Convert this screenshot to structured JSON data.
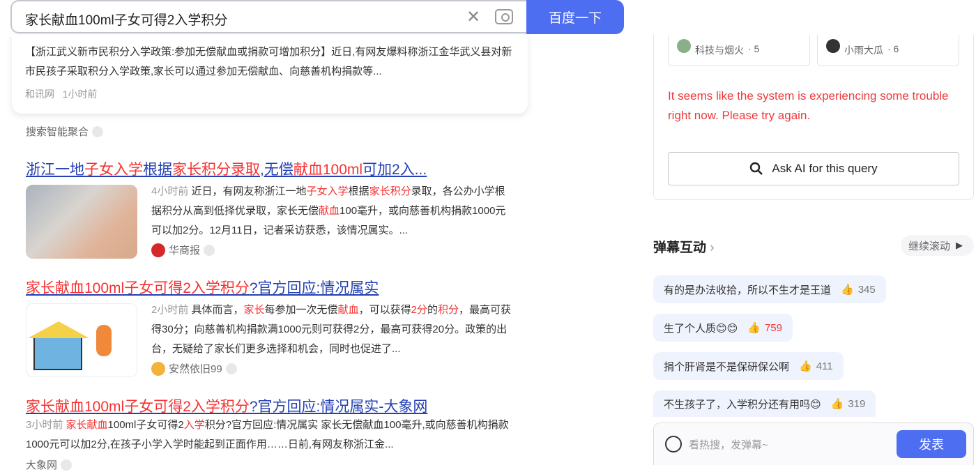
{
  "search": {
    "query": "家长献血100ml子女可得2入学积分",
    "button": "百度一下"
  },
  "top_card": {
    "snippet": "【浙江武义新市民积分入学政策:参加无偿献血或捐款可增加积分】近日,有网友爆料称浙江金华武义县对新市民孩子采取积分入学政策,家长可以通过参加无偿献血、向慈善机构捐款等...",
    "source": "和讯网",
    "time": "1小时前"
  },
  "aggregate_label": "搜索智能聚合",
  "results": [
    {
      "title": [
        [
          "浙江一地",
          0
        ],
        [
          "子女入学",
          1
        ],
        [
          "根据",
          0
        ],
        [
          "家长积分录取",
          1
        ],
        [
          ",无偿",
          0
        ],
        [
          "献血100ml",
          1
        ],
        [
          "可加2入...",
          0
        ]
      ],
      "snippet": [
        [
          "4小时前 ",
          2
        ],
        [
          "近日，有网友称浙江一地",
          0
        ],
        [
          "子女入学",
          1
        ],
        [
          "根据",
          0
        ],
        [
          "家长积分",
          1
        ],
        [
          "录取，各公办小学根据积分从高到低择优录取，家长无偿",
          0
        ],
        [
          "献血",
          1
        ],
        [
          "100毫升，或向慈善机构捐款1000元可以加2分。12月11日，记者采访获悉，该情况属实。...",
          0
        ]
      ],
      "source": "华商报"
    },
    {
      "title": [
        [
          "家长献血100ml子女可得2入学积分",
          1
        ],
        [
          "?官方回应:情况属实",
          0
        ]
      ],
      "snippet": [
        [
          "2小时前 ",
          2
        ],
        [
          "具体而言，",
          0
        ],
        [
          "家长",
          1
        ],
        [
          "每参加一次无偿",
          0
        ],
        [
          "献血",
          1
        ],
        [
          "，可以获得",
          0
        ],
        [
          "2分",
          1
        ],
        [
          "的",
          0
        ],
        [
          "积分",
          1
        ],
        [
          "，最高可获得30分；向慈善机构捐款满1000元则可获得2分，最高可获得20分。政策的出台，无疑给了家长们更多选择和机会，同时也促进了...",
          0
        ]
      ],
      "source": "安然依旧99"
    },
    {
      "title": [
        [
          "家长献血100ml子女可得2入学积分",
          1
        ],
        [
          "?官方回应:情况属实-大象网",
          0
        ]
      ],
      "snippet": [
        [
          "3小时前 ",
          2
        ],
        [
          "家长献血",
          1
        ],
        [
          "100ml子女可得2",
          0
        ],
        [
          "入学",
          1
        ],
        [
          "积分?官方回应:情况属实 家长无偿献血100毫升,或向慈善机构捐款1000元可以加2分,在孩子小学入学时能起到正面作用……日前,有网友称浙江金...",
          0
        ]
      ],
      "source": "大象网"
    }
  ],
  "right": {
    "chips": [
      {
        "name": "科技与烟火",
        "count": "· 5"
      },
      {
        "name": "小雨大瓜",
        "count": "· 6"
      }
    ],
    "error": "It seems like the system is experiencing some trouble right now. Please try again.",
    "ask_ai": "Ask AI for this query",
    "danmaku_title": "弹幕互动",
    "continue": "继续滚动",
    "danmaku": [
      {
        "text": "有的是办法收拾，所以不生才是王道",
        "likes": "345",
        "hot": false
      },
      {
        "text": "生了个人质😊😊",
        "likes": "759",
        "hot": true
      },
      {
        "text": "捐个肝肾是不是保研保公啊",
        "likes": "411",
        "hot": false
      },
      {
        "text": "不生孩子了，入学积分还有用吗😊",
        "likes": "319",
        "hot": false
      }
    ],
    "input_placeholder": "看热搜，发弹幕~",
    "publish": "发表"
  },
  "colors": {
    "accent": "#4e6ef2",
    "highlight": "#f73131",
    "link": "#2440b3",
    "error": "#f0393b"
  }
}
